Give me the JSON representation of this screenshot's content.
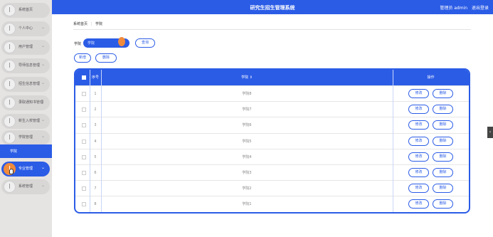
{
  "header": {
    "title": "研究生招生管理系统",
    "user": "管理员 admin",
    "logout": "退出登录"
  },
  "sidebar": {
    "items": [
      {
        "label": "系统首页",
        "has_arrow": false
      },
      {
        "label": "个人中心",
        "has_arrow": true
      },
      {
        "label": "用户管理",
        "has_arrow": true
      },
      {
        "label": "导师信息管理",
        "has_arrow": true
      },
      {
        "label": "招生信息管理",
        "has_arrow": true
      },
      {
        "label": "录取通知书管理",
        "has_arrow": true
      },
      {
        "label": "新生入校管理",
        "has_arrow": true
      },
      {
        "label": "学院管理",
        "has_arrow": true
      },
      {
        "label": "专业管理",
        "has_arrow": true
      },
      {
        "label": "系统管理",
        "has_arrow": true
      }
    ],
    "sub_item": "学院",
    "active": "专业管理"
  },
  "breadcrumb": {
    "home": "系统首页",
    "separator": "⋮",
    "current": "学院"
  },
  "search": {
    "label": "学院",
    "placeholder": "学院",
    "button": "查询"
  },
  "actions": {
    "add": "新增",
    "delete": "删除"
  },
  "table": {
    "headers": {
      "index": "序号",
      "college": "学院 ⇕",
      "ops": "操作"
    },
    "rows": [
      {
        "index": "1",
        "college": "学院8"
      },
      {
        "index": "2",
        "college": "学院7"
      },
      {
        "index": "3",
        "college": "学院6"
      },
      {
        "index": "4",
        "college": "学院5"
      },
      {
        "index": "5",
        "college": "学院4"
      },
      {
        "index": "6",
        "college": "学院3"
      },
      {
        "index": "7",
        "college": "学院2"
      },
      {
        "index": "8",
        "college": "学院1"
      }
    ],
    "edit_label": "修改",
    "delete_label": "删除"
  },
  "side_tab": "‹",
  "colors": {
    "primary": "#2b5ce6",
    "accent": "#f08a3c",
    "sidebar_bg": "#e6e3e3"
  }
}
